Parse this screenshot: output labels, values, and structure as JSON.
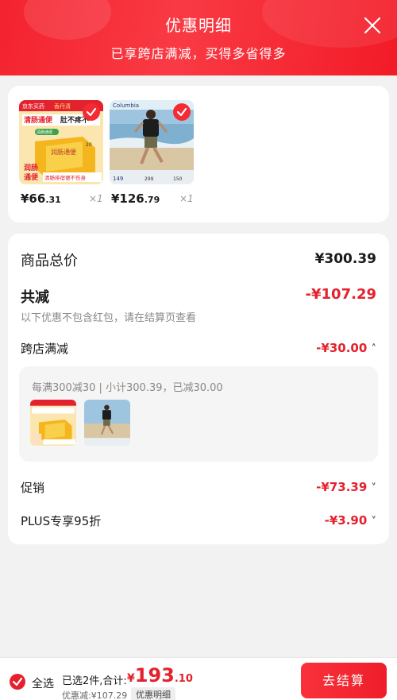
{
  "header": {
    "title": "优惠明细",
    "subtitle": "已享跨店满减，买得多省得多"
  },
  "products": [
    {
      "price_int": "¥66",
      "price_dec": ".31",
      "qty": "×1",
      "thumb_texts": [
        "京东买药",
        "香丹清",
        "清肠通便",
        "肚不疼不",
        "清肠通便",
        "润肠通便",
        "20",
        "润肠",
        "通便",
        "清肠排宿便不伤身"
      ]
    },
    {
      "price_int": "¥126",
      "price_dec": ".79",
      "qty": "×1",
      "thumb_texts": [
        "Columbia",
        "149",
        "299",
        "150"
      ]
    }
  ],
  "summary": {
    "total_label": "商品总价",
    "total_value": "¥300.39",
    "reduce_label": "共减",
    "reduce_value": "-¥107.29",
    "reduce_note": "以下优惠不包含红包，请在结算页查看",
    "items": [
      {
        "label": "跨店满减",
        "value": "-¥30.00",
        "chevron": "˄"
      },
      {
        "label": "促销",
        "value": "-¥73.39",
        "chevron": "˅"
      },
      {
        "label": "PLUS专享95折",
        "value": "-¥3.90",
        "chevron": "˅"
      }
    ],
    "cross_store_rule": "每满300减30 | 小计300.39，已减30.00"
  },
  "bottom": {
    "select_all": "全选",
    "selected_info": "已选2件,合计:",
    "total_currency": "¥",
    "total_int": "193",
    "total_dec": ".10",
    "saved": "优惠减:¥107.29",
    "detail_tag": "优惠明细",
    "checkout": "去结算"
  },
  "colors": {
    "brand_red": "#f42b35",
    "price_red": "#e3222d"
  }
}
